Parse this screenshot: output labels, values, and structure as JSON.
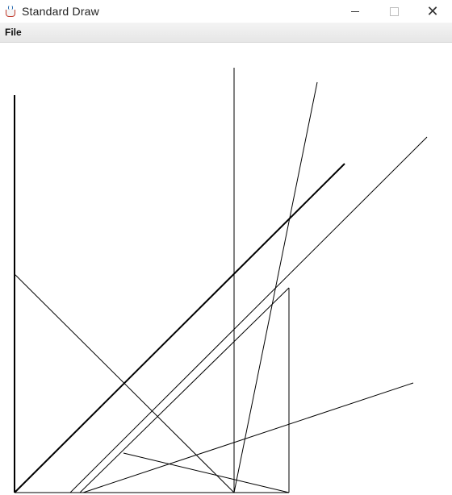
{
  "window": {
    "title": "Standard Draw",
    "icon": "java-cup-icon",
    "controls": {
      "minimize": "minimize-icon",
      "maximize": "maximize-icon",
      "close": "close-icon"
    },
    "close_glyph": "✕"
  },
  "menu": {
    "items": [
      {
        "label": "File"
      }
    ]
  },
  "drawing": {
    "line_color": "#000000",
    "background": "#ffffff"
  }
}
